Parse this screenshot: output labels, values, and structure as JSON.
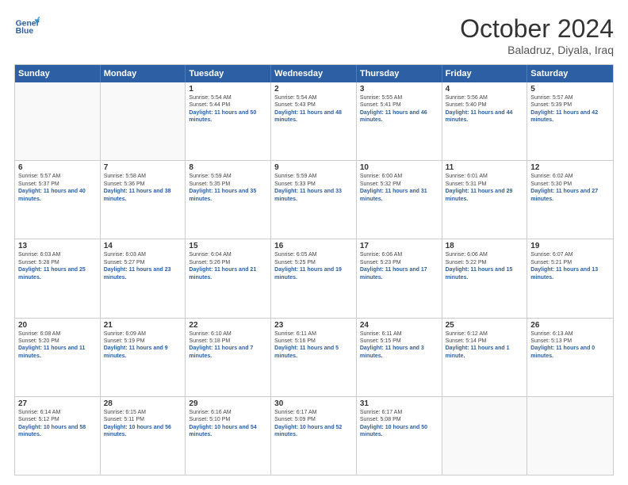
{
  "header": {
    "logo_line1": "General",
    "logo_line2": "Blue",
    "month_title": "October 2024",
    "location": "Baladruz, Diyala, Iraq"
  },
  "days_of_week": [
    "Sunday",
    "Monday",
    "Tuesday",
    "Wednesday",
    "Thursday",
    "Friday",
    "Saturday"
  ],
  "weeks": [
    [
      {
        "num": "",
        "empty": true
      },
      {
        "num": "",
        "empty": true
      },
      {
        "num": "1",
        "sunrise": "5:54 AM",
        "sunset": "5:44 PM",
        "daylight": "11 hours and 50 minutes."
      },
      {
        "num": "2",
        "sunrise": "5:54 AM",
        "sunset": "5:43 PM",
        "daylight": "11 hours and 48 minutes."
      },
      {
        "num": "3",
        "sunrise": "5:55 AM",
        "sunset": "5:41 PM",
        "daylight": "11 hours and 46 minutes."
      },
      {
        "num": "4",
        "sunrise": "5:56 AM",
        "sunset": "5:40 PM",
        "daylight": "11 hours and 44 minutes."
      },
      {
        "num": "5",
        "sunrise": "5:57 AM",
        "sunset": "5:39 PM",
        "daylight": "11 hours and 42 minutes."
      }
    ],
    [
      {
        "num": "6",
        "sunrise": "5:57 AM",
        "sunset": "5:37 PM",
        "daylight": "11 hours and 40 minutes."
      },
      {
        "num": "7",
        "sunrise": "5:58 AM",
        "sunset": "5:36 PM",
        "daylight": "11 hours and 38 minutes."
      },
      {
        "num": "8",
        "sunrise": "5:59 AM",
        "sunset": "5:35 PM",
        "daylight": "11 hours and 35 minutes."
      },
      {
        "num": "9",
        "sunrise": "5:59 AM",
        "sunset": "5:33 PM",
        "daylight": "11 hours and 33 minutes."
      },
      {
        "num": "10",
        "sunrise": "6:00 AM",
        "sunset": "5:32 PM",
        "daylight": "11 hours and 31 minutes."
      },
      {
        "num": "11",
        "sunrise": "6:01 AM",
        "sunset": "5:31 PM",
        "daylight": "11 hours and 29 minutes."
      },
      {
        "num": "12",
        "sunrise": "6:02 AM",
        "sunset": "5:30 PM",
        "daylight": "11 hours and 27 minutes."
      }
    ],
    [
      {
        "num": "13",
        "sunrise": "6:03 AM",
        "sunset": "5:28 PM",
        "daylight": "11 hours and 25 minutes."
      },
      {
        "num": "14",
        "sunrise": "6:03 AM",
        "sunset": "5:27 PM",
        "daylight": "11 hours and 23 minutes."
      },
      {
        "num": "15",
        "sunrise": "6:04 AM",
        "sunset": "5:26 PM",
        "daylight": "11 hours and 21 minutes."
      },
      {
        "num": "16",
        "sunrise": "6:05 AM",
        "sunset": "5:25 PM",
        "daylight": "11 hours and 19 minutes."
      },
      {
        "num": "17",
        "sunrise": "6:06 AM",
        "sunset": "5:23 PM",
        "daylight": "11 hours and 17 minutes."
      },
      {
        "num": "18",
        "sunrise": "6:06 AM",
        "sunset": "5:22 PM",
        "daylight": "11 hours and 15 minutes."
      },
      {
        "num": "19",
        "sunrise": "6:07 AM",
        "sunset": "5:21 PM",
        "daylight": "11 hours and 13 minutes."
      }
    ],
    [
      {
        "num": "20",
        "sunrise": "6:08 AM",
        "sunset": "5:20 PM",
        "daylight": "11 hours and 11 minutes."
      },
      {
        "num": "21",
        "sunrise": "6:09 AM",
        "sunset": "5:19 PM",
        "daylight": "11 hours and 9 minutes."
      },
      {
        "num": "22",
        "sunrise": "6:10 AM",
        "sunset": "5:18 PM",
        "daylight": "11 hours and 7 minutes."
      },
      {
        "num": "23",
        "sunrise": "6:11 AM",
        "sunset": "5:16 PM",
        "daylight": "11 hours and 5 minutes."
      },
      {
        "num": "24",
        "sunrise": "6:11 AM",
        "sunset": "5:15 PM",
        "daylight": "11 hours and 3 minutes."
      },
      {
        "num": "25",
        "sunrise": "6:12 AM",
        "sunset": "5:14 PM",
        "daylight": "11 hours and 1 minute."
      },
      {
        "num": "26",
        "sunrise": "6:13 AM",
        "sunset": "5:13 PM",
        "daylight": "11 hours and 0 minutes."
      }
    ],
    [
      {
        "num": "27",
        "sunrise": "6:14 AM",
        "sunset": "5:12 PM",
        "daylight": "10 hours and 58 minutes."
      },
      {
        "num": "28",
        "sunrise": "6:15 AM",
        "sunset": "5:11 PM",
        "daylight": "10 hours and 56 minutes."
      },
      {
        "num": "29",
        "sunrise": "6:16 AM",
        "sunset": "5:10 PM",
        "daylight": "10 hours and 54 minutes."
      },
      {
        "num": "30",
        "sunrise": "6:17 AM",
        "sunset": "5:09 PM",
        "daylight": "10 hours and 52 minutes."
      },
      {
        "num": "31",
        "sunrise": "6:17 AM",
        "sunset": "5:08 PM",
        "daylight": "10 hours and 50 minutes."
      },
      {
        "num": "",
        "empty": true
      },
      {
        "num": "",
        "empty": true
      }
    ]
  ]
}
